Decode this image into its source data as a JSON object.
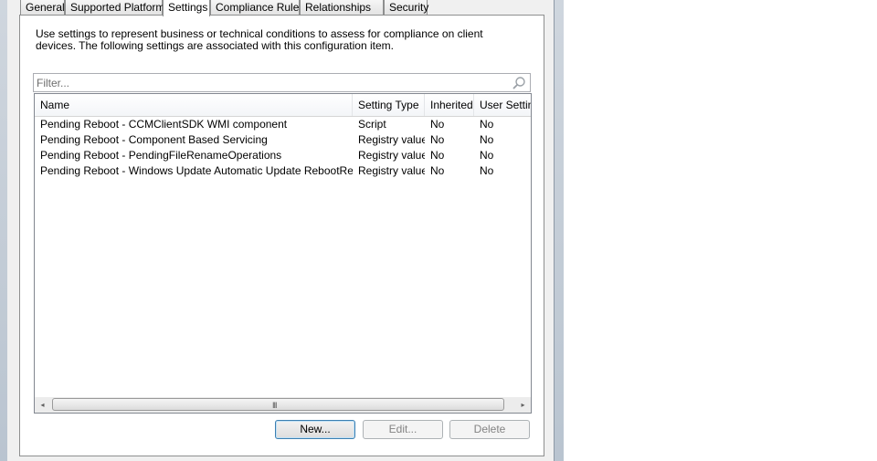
{
  "tabs": [
    {
      "label": "General"
    },
    {
      "label": "Supported Platforms"
    },
    {
      "label": "Settings"
    },
    {
      "label": "Compliance Rules"
    },
    {
      "label": "Relationships"
    },
    {
      "label": "Security"
    }
  ],
  "active_tab": "Settings",
  "description": "Use settings to represent business or technical conditions to assess for compliance on client devices. The following settings are associated with this configuration item.",
  "filter": {
    "placeholder": "Filter...",
    "icon": "search-icon"
  },
  "columns": [
    "Name",
    "Setting Type",
    "Inherited",
    "User Setting"
  ],
  "rows": [
    {
      "name": "Pending Reboot - CCMClientSDK WMI component",
      "type": "Script",
      "inherited": "No",
      "user": "No"
    },
    {
      "name": "Pending Reboot - Component Based Servicing",
      "type": "Registry value",
      "inherited": "No",
      "user": "No"
    },
    {
      "name": "Pending Reboot - PendingFileRenameOperations",
      "type": "Registry value",
      "inherited": "No",
      "user": "No"
    },
    {
      "name": "Pending Reboot - Windows Update Automatic Update RebootRequired",
      "type": "Registry value",
      "inherited": "No",
      "user": "No"
    }
  ],
  "scrollbar": {
    "left_arrow": "◂",
    "right_arrow": "▸",
    "grip": "III"
  },
  "buttons": {
    "new": "New...",
    "edit": "Edit...",
    "delete": "Delete"
  }
}
